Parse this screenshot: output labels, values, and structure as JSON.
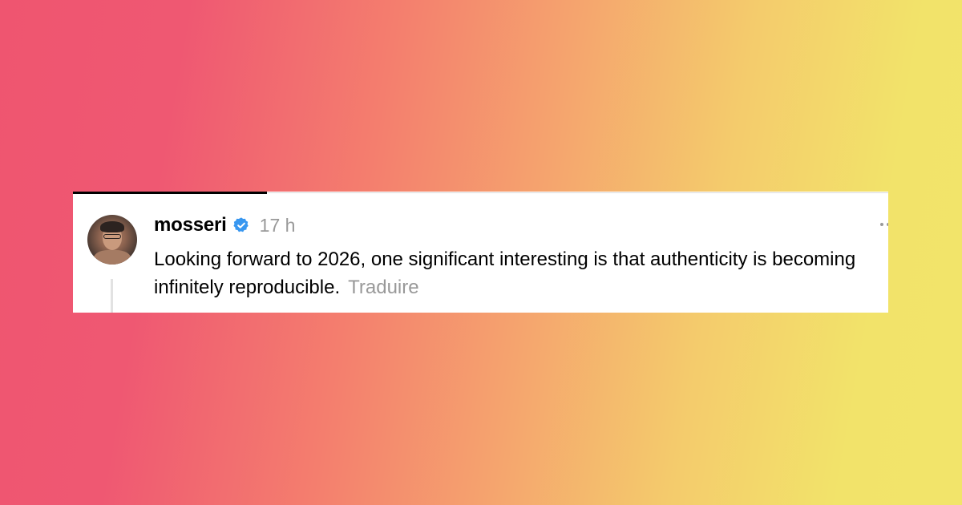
{
  "post": {
    "username": "mosseri",
    "verified": true,
    "timestamp": "17 h",
    "text": "Looking forward to 2026, one significant interesting is that authenticity is becoming infinitely reproducible.",
    "translate_label": "Traduire"
  },
  "icons": {
    "verified": "verified-badge-icon",
    "more": "more-options-icon",
    "avatar": "profile-avatar"
  },
  "colors": {
    "verified_badge": "#3897f0",
    "muted_text": "#999999",
    "gradient_start": "#ef5570",
    "gradient_end": "#f2e46a"
  }
}
